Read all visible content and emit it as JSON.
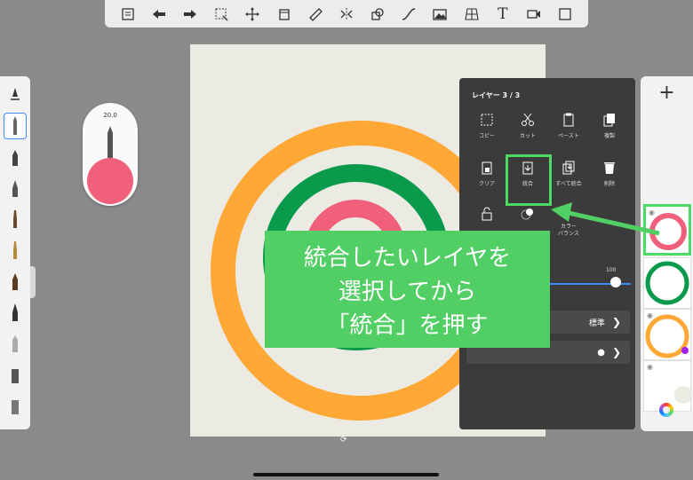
{
  "toolbar": {
    "icons": [
      "list-icon",
      "undo-icon",
      "redo-icon",
      "selection-icon",
      "transform-icon",
      "crop-icon",
      "ruler-icon",
      "symmetry-icon",
      "shapes-icon",
      "curve-icon",
      "image-icon",
      "perspective-icon",
      "text-icon",
      "video-icon",
      "fullscreen-icon"
    ],
    "text_icon_glyph": "T"
  },
  "brush_puck": {
    "size": "20.0",
    "color": "#f0607a"
  },
  "layer_menu": {
    "title": "レイヤー 3 / 3",
    "items": [
      {
        "label": "コピー",
        "icon": "copy-icon"
      },
      {
        "label": "カット",
        "icon": "scissors-icon"
      },
      {
        "label": "ペースト",
        "icon": "paste-icon"
      },
      {
        "label": "複製",
        "icon": "duplicate-icon"
      },
      {
        "label": "クリア",
        "icon": "clear-icon"
      },
      {
        "label": "統合",
        "icon": "merge-icon"
      },
      {
        "label": "すべて統合",
        "icon": "merge-all-icon"
      },
      {
        "label": "削除",
        "icon": "trash-icon"
      },
      {
        "label": "",
        "icon": "lock-icon"
      },
      {
        "label": "",
        "icon": "alpha-icon"
      },
      {
        "label": "カラー\nバランス",
        "icon": "color-balance-icon"
      }
    ],
    "opacity_max": "100",
    "blend_mode": "標準"
  },
  "callout": {
    "line1": "統合したいレイヤを",
    "line2": "選択してから",
    "line3": "「統合」を押す"
  },
  "colors": {
    "callout": "#52cf64",
    "orange_ring": "#ffa836",
    "green_ring": "#0a9a4c",
    "pink_ring": "#f0607a",
    "canvas_bg": "#ebebe4"
  }
}
